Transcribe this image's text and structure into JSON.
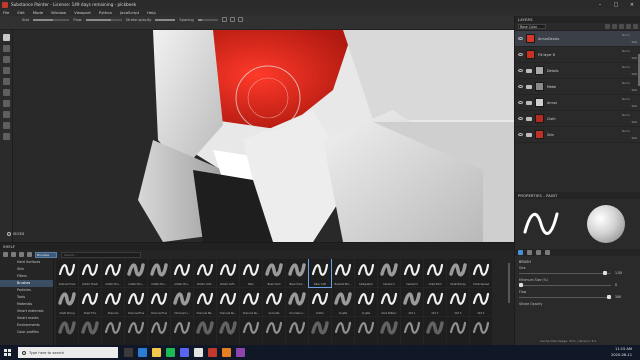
{
  "app": {
    "title": "Substance Painter - License: 149 days remaining - plckbeek"
  },
  "menu": [
    "File",
    "Edit",
    "Mode",
    "Window",
    "Viewport",
    "Python",
    "JavaScript",
    "Help"
  ],
  "toolbar": {
    "size_label": "Size",
    "flow_label": "Flow",
    "stroke_opacity_label": "Stroke opacity",
    "spacing_label": "Spacing",
    "size_value": 0.55,
    "flow_value": 0.7,
    "stroke_opacity_value": 1.0,
    "spacing_value": 0.2
  },
  "viewport": {
    "label": "ISO3D"
  },
  "layers": {
    "title": "LAYERS",
    "channel": "Base Color",
    "items": [
      {
        "name": "ArmorDecals",
        "type": "layer",
        "color": "#d9362a",
        "blend": "Norm",
        "opacity": "100",
        "selected": true
      },
      {
        "name": "Fill layer 8",
        "type": "layer",
        "color": "#c8301f",
        "blend": "Norm",
        "opacity": "100",
        "selected": false
      },
      {
        "name": "Details",
        "type": "folder",
        "color": "#a8a8a8",
        "blend": "Norm",
        "opacity": "100",
        "selected": false
      },
      {
        "name": "Metal",
        "type": "folder",
        "color": "#8a8a8a",
        "blend": "Norm",
        "opacity": "100",
        "selected": false
      },
      {
        "name": "Armor",
        "type": "folder",
        "color": "#d0d0d0",
        "blend": "Norm",
        "opacity": "100",
        "selected": false
      },
      {
        "name": "Cloth",
        "type": "folder",
        "color": "#b32a21",
        "blend": "Norm",
        "opacity": "100",
        "selected": false
      },
      {
        "name": "Skin",
        "type": "folder",
        "color": "#c03126",
        "blend": "Norm",
        "opacity": "100",
        "selected": false
      }
    ]
  },
  "properties": {
    "title": "PROPERTIES - PAINT",
    "section": "BRUSH",
    "size_label": "Size",
    "size_value": "1.55",
    "size_fraction": 0.95,
    "min_size_label": "Minimum Size (%)",
    "min_size_value": "0",
    "min_size_fraction": 0.0,
    "flow_label": "Flow",
    "flow_value": "100",
    "flow_fraction": 1.0,
    "stroke_opacity_label": "Stroke Opacity"
  },
  "shelf": {
    "title": "SHELF",
    "filter": "Brushes",
    "search_placeholder": "Search...",
    "categories": [
      "Hard Surfaces",
      "Skin",
      "Filters",
      "Brushes",
      "Particles",
      "Tools",
      "Materials",
      "Smart materials",
      "Smart masks",
      "Environments",
      "Color profiles"
    ],
    "active_category": "Brushes",
    "brushes": [
      "Airbrush Hard",
      "Artistic Brush",
      "Artistic Bru...",
      "Artistic Bru...",
      "Artistic Bru...",
      "Artistic Bru...",
      "Artistic Soft...",
      "Artistic Soft...",
      "Bark",
      "Basic Hard",
      "Basic Hard...",
      "Basic Soft",
      "Basmati Bru...",
      "Calligraphic",
      "Cement 1",
      "Cement 2",
      "Chalk Bold",
      "Chalk Bumpy",
      "Chalk Spread",
      "Chalk Strong",
      "Chalk Thin",
      "Charcoal",
      "Charcoal Fine",
      "Charcoal Fine",
      "Charcoal Li...",
      "Charcoal Ma...",
      "Charcoal No...",
      "Charcoal Ro...",
      "Concrete",
      "Concrete Li...",
      "Cotton",
      "Crystal",
      "Crystal",
      "Dark Pattern",
      "Dirt 1",
      "Dirt 2",
      "Dirt 3",
      "Dirt 4",
      "",
      "",
      "",
      "",
      "",
      "",
      "",
      "",
      "",
      "",
      "",
      "",
      "",
      "",
      "",
      "",
      "",
      "",
      ""
    ],
    "selected_brush": "Basic Soft"
  },
  "status": {
    "message": "Cache Disk Usage: 31% | Version: 6.1",
    "search_placeholder": "Type here to search",
    "time": "11:15 AM",
    "date": "2020-06-11"
  },
  "colors": {
    "accent": "#4a90d9",
    "brand_red": "#d9362a"
  }
}
